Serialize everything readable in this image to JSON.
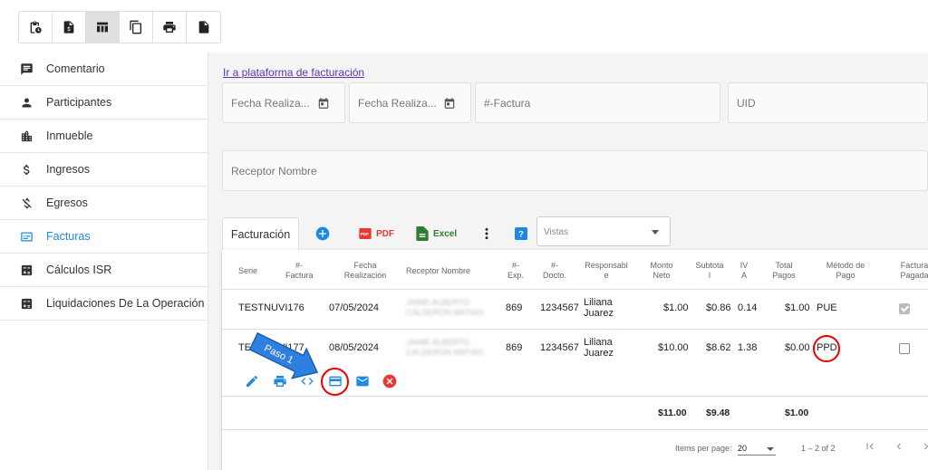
{
  "toolbar": {
    "icons": [
      "clipboard-clock-icon",
      "invoice-dollar-icon",
      "table-icon",
      "copy-icon",
      "print-icon",
      "document-icon"
    ]
  },
  "sidebar": {
    "items": [
      {
        "label": "Comentario",
        "icon": "comment-icon"
      },
      {
        "label": "Participantes",
        "icon": "person-icon"
      },
      {
        "label": "Inmueble",
        "icon": "building-icon"
      },
      {
        "label": "Ingresos",
        "icon": "dollar-icon"
      },
      {
        "label": "Egresos",
        "icon": "dollar-off-icon"
      },
      {
        "label": "Facturas",
        "icon": "receipt-icon",
        "active": true
      },
      {
        "label": "Cálculos ISR",
        "icon": "calculator-icon"
      },
      {
        "label": "Liquidaciones De La Operación",
        "icon": "calculator-icon"
      }
    ]
  },
  "main": {
    "link": "Ir a plataforma de facturación",
    "filters": {
      "fecha1": "Fecha Realiza...",
      "fecha2": "Fecha Realiza...",
      "factura": "#-Factura",
      "uid": "UID",
      "receptor": "Receptor Nombre"
    },
    "tab": "Facturación",
    "pdf_label": "PDF",
    "excel_label": "Excel",
    "vistas_placeholder": "Vistas"
  },
  "table": {
    "headers": {
      "serie": "Serie",
      "factura": "#-\nFactura",
      "fecha": "Fecha\nRealización",
      "receptor": "Receptor Nombre",
      "exp": "#-\nExp.",
      "docto": "#-\nDocto.",
      "responsable": "Responsabl\ne",
      "monto": "Monto\nNeto",
      "subtotal": "Subtota\nl",
      "iva": "IV\nA",
      "total": "Total\nPagos",
      "metodo": "Método de\nPago",
      "pagada": "Factura\nPagada"
    },
    "rows": [
      {
        "serie": "TESTNUVI176",
        "fecha": "07/05/2024",
        "receptor": "JAIME ALBERTO\nCALDERON MATIAS",
        "exp": "869",
        "docto": "1234567",
        "responsable": "Liliana\nJuarez",
        "monto": "$1.00",
        "subtotal": "$0.86",
        "iva": "0.14",
        "total": "$1.00",
        "metodo": "PUE",
        "pagada": true
      },
      {
        "serie": "TESTNUVI177",
        "fecha": "08/05/2024",
        "receptor": "JAIME ALBERTO\nCALDERON MATIAS",
        "exp": "869",
        "docto": "1234567",
        "responsable": "Liliana\nJuarez",
        "monto": "$10.00",
        "subtotal": "$8.62",
        "iva": "1.38",
        "total": "$0.00",
        "metodo": "PPD",
        "pagada": false
      }
    ],
    "totals": {
      "monto": "$11.00",
      "subtotal": "$9.48",
      "total": "$1.00"
    },
    "pager": {
      "items_label": "Items per page:",
      "page_size": "20",
      "range": "1 – 2 of 2"
    }
  },
  "annotation": {
    "arrow_label": "Paso 1",
    "color": "#e00000",
    "arrow_color": "#2f7fe0"
  }
}
